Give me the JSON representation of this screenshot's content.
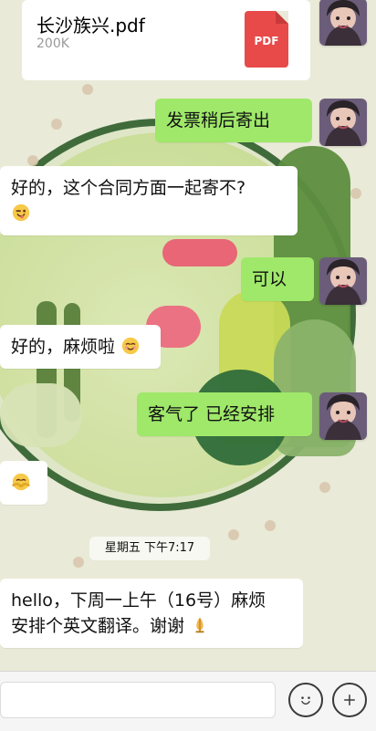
{
  "file_message": {
    "file_name": "长沙族兴.pdf",
    "file_size": "200K",
    "file_type_label": "PDF",
    "file_icon": "pdf-icon"
  },
  "messages": [
    {
      "side": "out",
      "text": "发票稍后寄出"
    },
    {
      "side": "in",
      "text": "好的，这个合同方面一起寄不?"
    },
    {
      "side": "out",
      "text": "可以"
    },
    {
      "side": "in",
      "text": "好的，麻烦啦"
    },
    {
      "side": "out",
      "text": "客气了 已经安排"
    },
    {
      "side": "in",
      "text": ""
    }
  ],
  "timestamp": "星期五 下午7:17",
  "last_message": {
    "line1": "hello，下周一上午（16号）麻烦",
    "line2": "安排个英文翻译。谢谢"
  },
  "input_bar": {
    "emoji_button_icon": "smile-icon",
    "add_button_icon": "plus-icon"
  },
  "colors": {
    "outgoing_bubble": "#9fe86a",
    "incoming_bubble": "#ffffff",
    "pdf_red": "#e84a4a"
  }
}
